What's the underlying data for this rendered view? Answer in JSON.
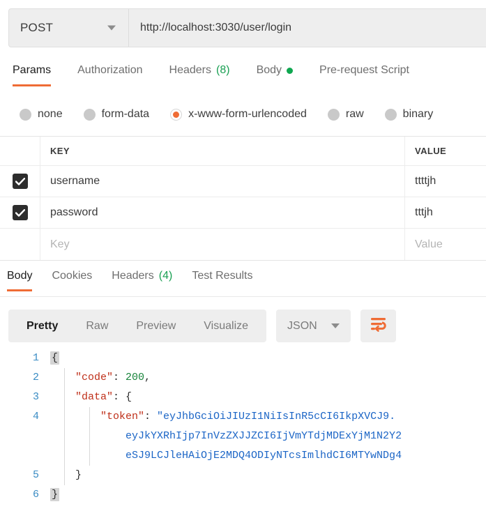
{
  "request": {
    "method": "POST",
    "url": "http://localhost:3030/user/login",
    "tabs": [
      {
        "label": "Params",
        "count": "",
        "active": false,
        "dot": false
      },
      {
        "label": "Authorization",
        "count": "",
        "active": false,
        "dot": false
      },
      {
        "label": "Headers",
        "count": "(8)",
        "active": false,
        "dot": false
      },
      {
        "label": "Body",
        "count": "",
        "active": true,
        "dot": true
      },
      {
        "label": "Pre-request Script",
        "count": "",
        "active": false,
        "dot": false
      }
    ],
    "body_types": [
      {
        "label": "none",
        "selected": false
      },
      {
        "label": "form-data",
        "selected": false
      },
      {
        "label": "x-www-form-urlencoded",
        "selected": true
      },
      {
        "label": "raw",
        "selected": false
      },
      {
        "label": "binary",
        "selected": false
      }
    ],
    "table": {
      "headers": {
        "key": "KEY",
        "value": "VALUE"
      },
      "rows": [
        {
          "checked": true,
          "key": "username",
          "value": "ttttjh",
          "placeholder": false
        },
        {
          "checked": true,
          "key": "password",
          "value": "tttjh",
          "placeholder": false
        },
        {
          "checked": false,
          "key": "Key",
          "value": "Value",
          "placeholder": true
        }
      ]
    }
  },
  "response": {
    "tabs": [
      {
        "label": "Body",
        "count": "",
        "active": true
      },
      {
        "label": "Cookies",
        "count": "",
        "active": false
      },
      {
        "label": "Headers",
        "count": "(4)",
        "active": false
      },
      {
        "label": "Test Results",
        "count": "",
        "active": false
      }
    ],
    "view_modes": [
      {
        "label": "Pretty",
        "active": true
      },
      {
        "label": "Raw",
        "active": false
      },
      {
        "label": "Preview",
        "active": false
      },
      {
        "label": "Visualize",
        "active": false
      }
    ],
    "format": "JSON",
    "wrap_icon": "word-wrap-icon",
    "body": {
      "line_numbers": [
        "1",
        "2",
        "3",
        "4",
        "5",
        "6"
      ],
      "open_brace": "{",
      "code_key": "\"code\"",
      "code_colon": ": ",
      "code_value": "200",
      "code_comma": ",",
      "data_key": "\"data\"",
      "data_colon": ": ",
      "data_open": "{",
      "token_key": "\"token\"",
      "token_colon": ": ",
      "token_part1": "\"eyJhbGciOiJIUzI1NiIsInR5cCI6IkpXVCJ9.",
      "token_part2": "eyJkYXRhIjp7InVzZXJJZCI6IjVmYTdjMDExYjM1N2Y2",
      "token_part3": "eSJ9LCJleHAiOjE2MDQ4ODIyNTcsImlhdCI6MTYwNDg4",
      "close_inner": "}",
      "close_outer": "}"
    }
  },
  "colors": {
    "accent": "#ef6c35",
    "green": "#0fa750",
    "string": "#1b65c6",
    "key": "#bf2f19",
    "number": "#18843b",
    "gutter": "#3a8cc4"
  }
}
